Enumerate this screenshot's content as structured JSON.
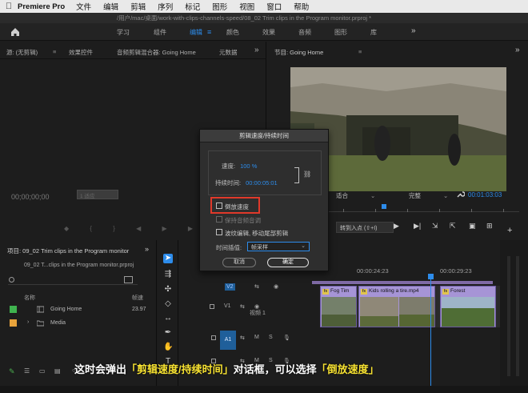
{
  "menubar": {
    "app_name": "Premiere Pro",
    "items": [
      "文件",
      "编辑",
      "剪辑",
      "序列",
      "标记",
      "图形",
      "视图",
      "窗口",
      "帮助"
    ]
  },
  "titlebar": {
    "path": "/用户/mac/桌面/work-with-clips-channels-speed/08_02 Trim clips in the Program monitor.prproj *"
  },
  "workspace": {
    "tabs": [
      "学习",
      "组件",
      "编辑",
      "颜色",
      "效果",
      "音频",
      "图形",
      "库"
    ],
    "active_tab": "编辑"
  },
  "source_panel": {
    "tabs": [
      "源: (无剪辑)",
      "效果控件",
      "音频剪辑混合器: Going Home",
      "元数据"
    ],
    "timecode": "00;00;00;00",
    "grey_box": "1 适应"
  },
  "program_panel": {
    "tab": "节目: Going Home",
    "fit": "适合",
    "quality": "完整",
    "timecode": "00:01:03:03",
    "goto_in": "转到入点 (⇧+I)"
  },
  "project_panel": {
    "tab": "项目: 09_02 Trim clips in the Program monitor",
    "file": "09_02 T...clips in the Program monitor.prproj",
    "columns": {
      "name": "名称",
      "fps": "帧速"
    },
    "rows": [
      {
        "name": "Going Home",
        "fps": "23.97",
        "color": "#3fb34f"
      },
      {
        "name": "Media",
        "fps": "",
        "color": "#e8a33b"
      }
    ]
  },
  "timeline": {
    "timecode_1": "00:00:24:23",
    "timecode_2": "00:00:29:23",
    "tracks": {
      "v2": "V2",
      "v1": "V1",
      "v1_name": "视频 1",
      "a1": "A1"
    },
    "clips": [
      "Fog Tim",
      "Kids rolling a tire.mp4",
      "Forest"
    ]
  },
  "dialog": {
    "title": "剪辑速度/持续时间",
    "speed_label": "速度:",
    "speed_value": "100 %",
    "duration_label": "持续时间:",
    "duration_value": "00:00:05:01",
    "reverse_label": "倒放速度",
    "maintain_pitch": "保持音频音调",
    "ripple_label": "波纹编辑, 移动尾部剪辑",
    "interp_label": "时间插值:",
    "interp_value": "帧采样",
    "cancel": "取消",
    "ok": "确定"
  },
  "caption": {
    "pre": "这时会弹出",
    "hl1": "「剪辑速度/持续时间」",
    "mid": "对话框，可以选择",
    "hl2": "「倒放速度」"
  },
  "colors": {
    "accent_blue": "#2d8ceb",
    "clip_purple": "#a694d6",
    "highlight_red": "#e0392a",
    "caption_yellow": "#f7e232"
  }
}
